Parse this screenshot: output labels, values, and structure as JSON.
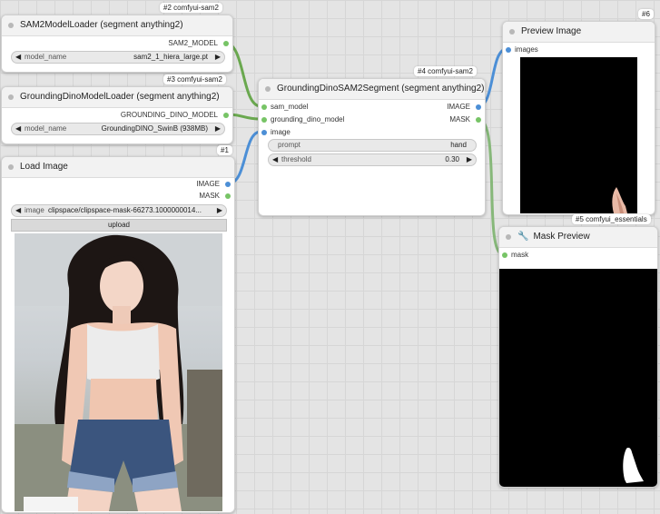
{
  "colors": {
    "canvas": "#e4e4e4",
    "node_bg": "#ffffff",
    "title_bg": "#f2f2f2",
    "sam_link": "#6aa84f",
    "image_link": "#4c8fd6",
    "mask_link": "#87b87a"
  },
  "nodes": {
    "sam2_loader": {
      "tag": "#2 comfyui-sam2",
      "title": "SAM2ModelLoader (segment anything2)",
      "output": "SAM2_MODEL",
      "widget_name": "model_name",
      "widget_value": "sam2_1_hiera_large.pt"
    },
    "dino_loader": {
      "tag": "#3 comfyui-sam2",
      "title": "GroundingDinoModelLoader (segment anything2)",
      "output": "GROUNDING_DINO_MODEL",
      "widget_name": "model_name",
      "widget_value": "GroundingDINO_SwinB (938MB)"
    },
    "load_image": {
      "tag": "#1",
      "title": "Load Image",
      "outputs": [
        "IMAGE",
        "MASK"
      ],
      "widget_name": "image",
      "widget_value": "clipspace/clipspace-mask-66273.1000000014...",
      "upload_label": "upload"
    },
    "segment": {
      "tag": "#4 comfyui-sam2",
      "title": "GroundingDinoSAM2Segment (segment anything2)",
      "inputs": [
        "sam_model",
        "grounding_dino_model",
        "image"
      ],
      "outputs": [
        "IMAGE",
        "MASK"
      ],
      "prompt_name": "prompt",
      "prompt_value": "hand",
      "threshold_name": "threshold",
      "threshold_value": "0.30"
    },
    "preview": {
      "tag": "#6",
      "title": "Preview Image",
      "input": "images"
    },
    "mask_preview": {
      "tag": "#5 comfyui_essentials",
      "title": "Mask Preview",
      "input": "mask"
    }
  }
}
